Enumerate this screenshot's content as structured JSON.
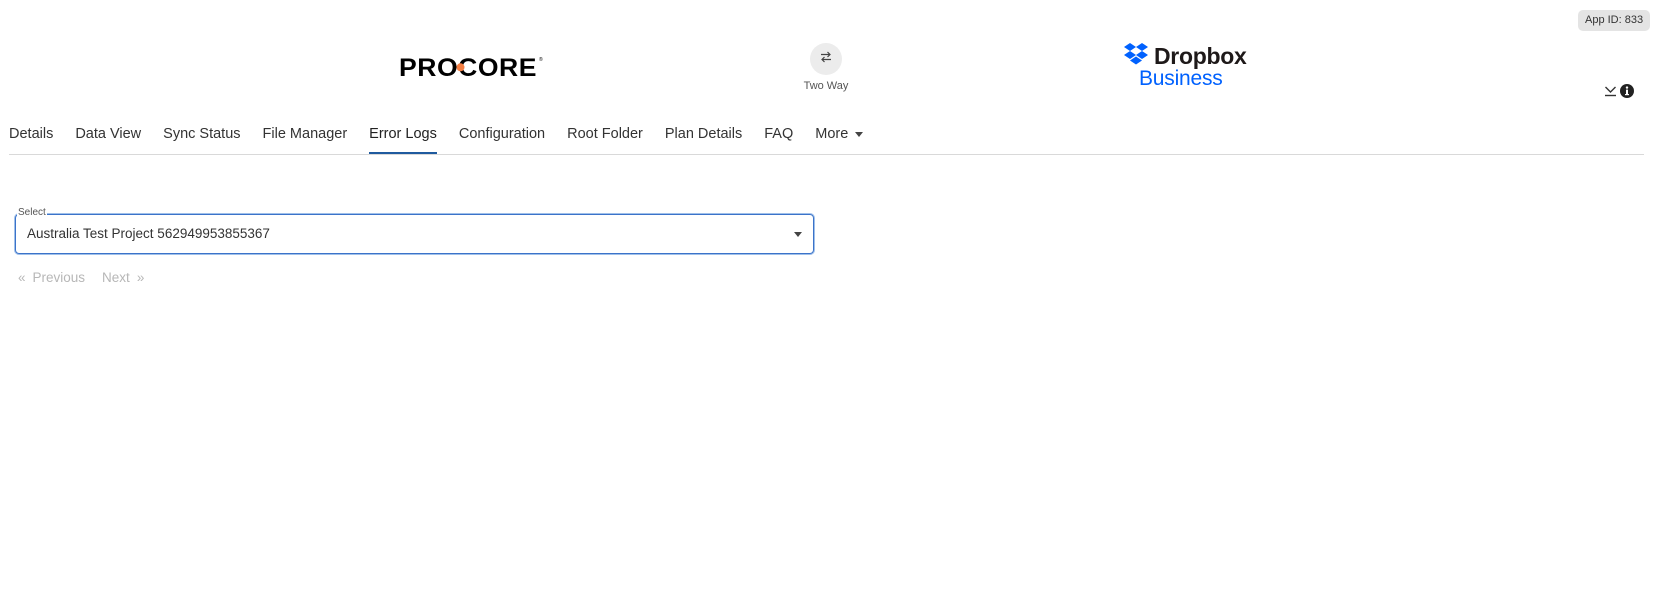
{
  "app": {
    "app_id_label": "App ID: 833",
    "procore_logo_text": "PROCORE",
    "sync_mode_label": "Two Way",
    "dropbox_logo_text": "Dropbox",
    "dropbox_logo_subtext": "Business"
  },
  "icons": {
    "sync": "swap-arrows-icon",
    "collapse": "chevron-down-line-icon",
    "info": "info-circle-icon"
  },
  "tabs": [
    {
      "label": "Details",
      "active": false
    },
    {
      "label": "Data View",
      "active": false
    },
    {
      "label": "Sync Status",
      "active": false
    },
    {
      "label": "File Manager",
      "active": false
    },
    {
      "label": "Error Logs",
      "active": true
    },
    {
      "label": "Configuration",
      "active": false
    },
    {
      "label": "Root Folder",
      "active": false
    },
    {
      "label": "Plan Details",
      "active": false
    },
    {
      "label": "FAQ",
      "active": false
    },
    {
      "label": "More",
      "active": false
    }
  ],
  "project_select": {
    "label": "Select",
    "value": "Australia Test Project 562949953855367"
  },
  "pagination": {
    "previous_symbol": "«",
    "previous_label": "Previous",
    "next_label": "Next",
    "next_symbol": "»"
  },
  "colors": {
    "active_tab_underline": "#1f5a9e",
    "dropbox_blue": "#0061fe",
    "procore_orange": "#f47e42",
    "select_focus_border": "#3b73c9",
    "disabled_text": "#b7b7b7"
  }
}
